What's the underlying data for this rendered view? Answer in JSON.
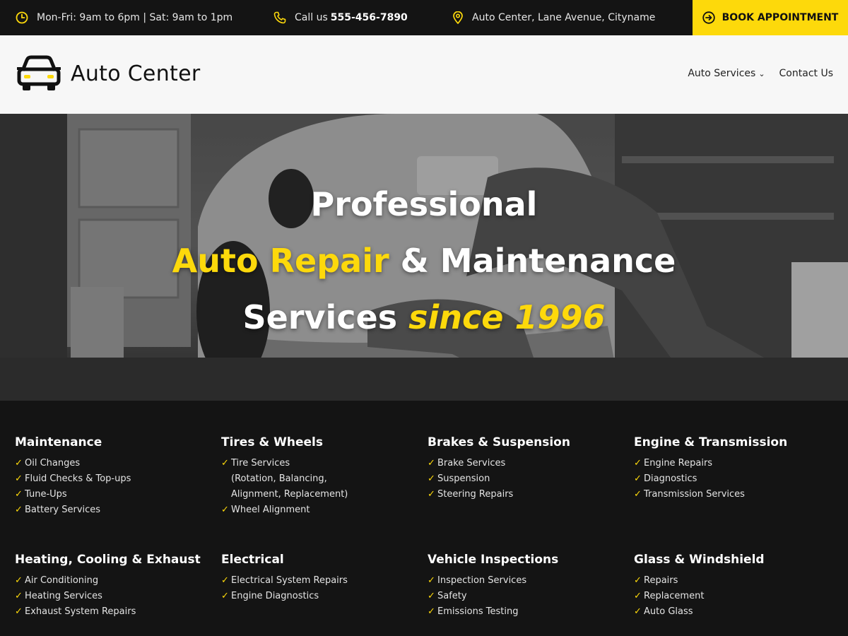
{
  "topbar": {
    "hours": "Mon-Fri: 9am to 6pm | Sat: 9am to 1pm",
    "call_prefix": "Call us",
    "phone": "555-456-7890",
    "address": "Auto Center, Lane Avenue, Cityname",
    "book_label": "BOOK APPOINTMENT"
  },
  "header": {
    "brand": "Auto Center",
    "nav": [
      {
        "label": "Auto Services",
        "has_dropdown": true
      },
      {
        "label": "Contact Us",
        "has_dropdown": false
      }
    ]
  },
  "hero": {
    "line1": "Professional",
    "line2_highlight": "Auto Repair",
    "line2_rest": "& Maintenance",
    "line3_start": "Services",
    "line3_highlight": "since 1996"
  },
  "services": [
    {
      "title": "Maintenance",
      "items": [
        "Oil Changes",
        "Fluid Checks & Top-ups",
        "Tune-Ups",
        "Battery Services"
      ]
    },
    {
      "title": "Tires & Wheels",
      "items": [
        "Tire Services\n(Rotation, Balancing,\nAlignment, Replacement)",
        "Wheel Alignment"
      ]
    },
    {
      "title": "Brakes & Suspension",
      "items": [
        "Brake Services",
        "Suspension",
        "Steering Repairs"
      ]
    },
    {
      "title": "Engine & Transmission",
      "items": [
        "Engine Repairs",
        "Diagnostics",
        "Transmission Services"
      ]
    },
    {
      "title": "Heating, Cooling & Exhaust",
      "items": [
        "Air Conditioning",
        "Heating Services",
        "Exhaust System Repairs"
      ]
    },
    {
      "title": "Electrical",
      "items": [
        "Electrical System Repairs",
        "Engine Diagnostics"
      ]
    },
    {
      "title": "Vehicle Inspections",
      "items": [
        "Inspection Services",
        "Safety",
        "Emissions Testing"
      ]
    },
    {
      "title": "Glass & Windshield",
      "items": [
        "Repairs",
        "Replacement",
        "Auto Glass"
      ]
    }
  ],
  "colors": {
    "accent": "#fdd90b",
    "dark": "#141414",
    "header_bg": "#f7f7f7"
  },
  "icons": {
    "hours": "clock-icon",
    "phone": "phone-icon",
    "address": "map-pin-icon",
    "book": "arrow-circle-icon",
    "logo": "car-icon"
  }
}
